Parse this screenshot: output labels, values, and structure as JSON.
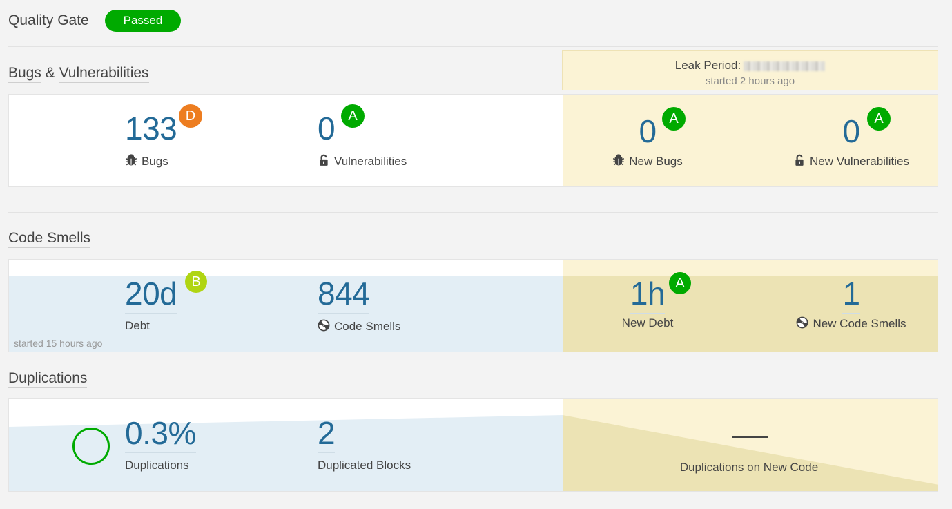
{
  "quality_gate": {
    "title": "Quality Gate",
    "status": "Passed"
  },
  "leak_period": {
    "label": "Leak Period:",
    "started": "started 2 hours ago"
  },
  "bugs_section": {
    "title_part1": "Bugs",
    "title_amp": "&",
    "title_part2": "Vulnerabilities",
    "bugs": {
      "value": "133",
      "label": "Bugs",
      "rating": "D"
    },
    "vulnerabilities": {
      "value": "0",
      "label": "Vulnerabilities",
      "rating": "A"
    },
    "new_bugs": {
      "value": "0",
      "label": "New Bugs",
      "rating": "A"
    },
    "new_vulnerabilities": {
      "value": "0",
      "label": "New Vulnerabilities",
      "rating": "A"
    }
  },
  "code_smells_section": {
    "title": "Code Smells",
    "debt": {
      "value": "20d",
      "label": "Debt",
      "rating": "B"
    },
    "code_smells": {
      "value": "844",
      "label": "Code Smells"
    },
    "new_debt": {
      "value": "1h",
      "label": "New Debt",
      "rating": "A"
    },
    "new_code_smells": {
      "value": "1",
      "label": "New Code Smells"
    },
    "started": "started 15 hours ago"
  },
  "duplications_section": {
    "title": "Duplications",
    "duplications": {
      "value": "0.3%",
      "label": "Duplications"
    },
    "duplicated_blocks": {
      "value": "2",
      "label": "Duplicated Blocks"
    },
    "new_duplications": {
      "value": "—",
      "label": "Duplications on New Code"
    }
  },
  "colors": {
    "rating_a": "#00aa00",
    "rating_b": "#b0d513",
    "rating_d": "#ed7d20",
    "measure_value": "#236a97",
    "leak_bg": "#fbf3d5",
    "leak_chart": "#ece3b4",
    "history_chart": "#e3eef5"
  },
  "icons": {
    "bug": "bug-icon",
    "vulnerability": "lock-icon",
    "code_smell": "radiation-icon"
  }
}
